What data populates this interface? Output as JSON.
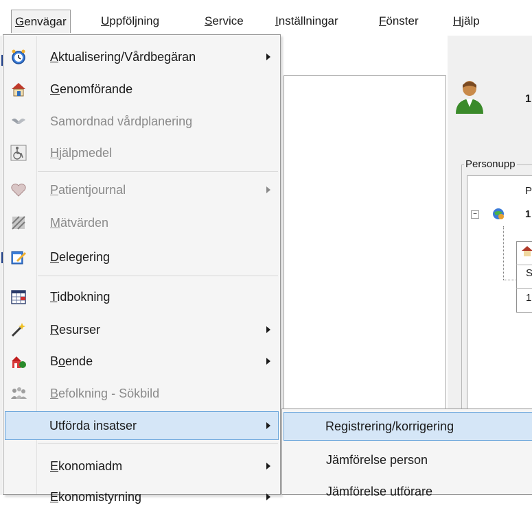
{
  "menubar": {
    "items": [
      {
        "pre": "",
        "mnemonic": "G",
        "post": "envägar"
      },
      {
        "pre": "",
        "mnemonic": "U",
        "post": "ppföljning"
      },
      {
        "pre": "",
        "mnemonic": "S",
        "post": "ervice"
      },
      {
        "pre": "",
        "mnemonic": "I",
        "post": "nställningar"
      },
      {
        "pre": "",
        "mnemonic": "F",
        "post": "önster"
      },
      {
        "pre": "",
        "mnemonic": "H",
        "post": "jälp"
      }
    ]
  },
  "menu": {
    "items": [
      {
        "pre": "",
        "mnemonic": "A",
        "post": "ktualisering/Vårdbegäran",
        "icon": "alarm-clock-icon",
        "submenu": true,
        "enabled": true
      },
      {
        "pre": "",
        "mnemonic": "G",
        "post": "enomförande",
        "icon": "house-icon",
        "submenu": false,
        "enabled": true
      },
      {
        "pre": "Samordnad vårdplanering",
        "mnemonic": "",
        "post": "",
        "icon": "handshake-icon",
        "submenu": false,
        "enabled": false
      },
      {
        "pre": "",
        "mnemonic": "H",
        "post": "jälpmedel",
        "icon": "wheelchair-icon",
        "submenu": false,
        "enabled": false
      },
      {
        "pre": "",
        "mnemonic": "P",
        "post": "atientjournal",
        "icon": "heart-icon",
        "submenu": true,
        "enabled": false
      },
      {
        "pre": "",
        "mnemonic": "M",
        "post": "ätvärden",
        "icon": "measurements-icon",
        "submenu": false,
        "enabled": false
      },
      {
        "pre": "",
        "mnemonic": "D",
        "post": "elegering",
        "icon": "delegation-icon",
        "submenu": false,
        "enabled": true
      },
      {
        "pre": "",
        "mnemonic": "T",
        "post": "idbokning",
        "icon": "calendar-icon",
        "submenu": false,
        "enabled": true
      },
      {
        "pre": "",
        "mnemonic": "R",
        "post": "esurser",
        "icon": "magic-wand-icon",
        "submenu": true,
        "enabled": true
      },
      {
        "pre": "B",
        "mnemonic": "o",
        "post": "ende",
        "icon": "residence-icon",
        "submenu": true,
        "enabled": true
      },
      {
        "pre": "",
        "mnemonic": "B",
        "post": "efolkning - Sökbild",
        "icon": "population-icon",
        "submenu": false,
        "enabled": false
      },
      {
        "pre": "Utförda insatser",
        "mnemonic": "",
        "post": "",
        "icon": "",
        "submenu": true,
        "enabled": true
      },
      {
        "pre": "",
        "mnemonic": "E",
        "post": "konomiadm",
        "icon": "",
        "submenu": true,
        "enabled": true
      },
      {
        "pre": "",
        "mnemonic": "E",
        "post": "konomistyrning",
        "icon": "",
        "submenu": true,
        "enabled": true
      }
    ]
  },
  "submenu": {
    "items": [
      {
        "label": "Registrering/korrigering"
      },
      {
        "label": "Jämförelse person"
      },
      {
        "label": "Jämförelse utförare"
      }
    ]
  },
  "background": {
    "digit_label": "1",
    "group_label": "Personupp",
    "grid_header_letter": "P",
    "tree_row_value": "1",
    "inner_row_1": "S",
    "inner_row_2": "1"
  },
  "colors": {
    "highlight_fill": "#d5e6f7",
    "highlight_border": "#6aa5db",
    "menu_bg": "#f5f5f5"
  }
}
